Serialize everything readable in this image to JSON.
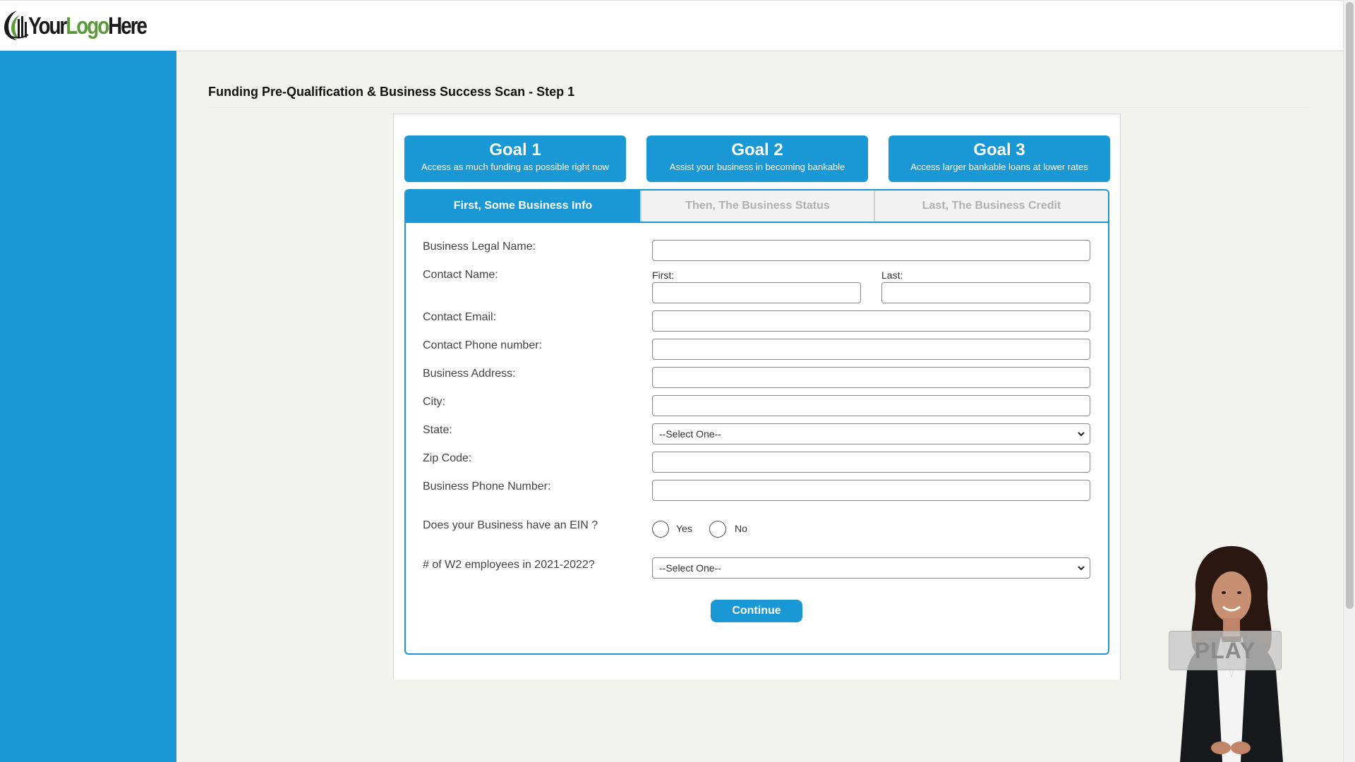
{
  "header": {
    "logo": {
      "your": "Your",
      "logo": "Logo",
      "here": "Here",
      "icon": "building-swoosh-icon"
    }
  },
  "page": {
    "title": "Funding Pre-Qualification & Business Success Scan - Step 1"
  },
  "goals": [
    {
      "title": "Goal 1",
      "subtitle": "Access as much funding as possible right now"
    },
    {
      "title": "Goal 2",
      "subtitle": "Assist your business in becoming bankable"
    },
    {
      "title": "Goal 3",
      "subtitle": "Access larger bankable loans at lower rates"
    }
  ],
  "tabs": [
    {
      "label": "First, Some Business Info",
      "active": true
    },
    {
      "label": "Then, The Business Status",
      "active": false
    },
    {
      "label": "Last, The Business Credit",
      "active": false
    }
  ],
  "form": {
    "business_legal_name": {
      "label": "Business Legal Name:",
      "value": ""
    },
    "contact_name": {
      "label": "Contact Name:",
      "first_label": "First:",
      "last_label": "Last:",
      "first_value": "",
      "last_value": ""
    },
    "contact_email": {
      "label": "Contact Email:",
      "value": ""
    },
    "contact_phone": {
      "label": "Contact Phone number:",
      "value": ""
    },
    "business_address": {
      "label": "Business Address:",
      "value": ""
    },
    "city": {
      "label": "City:",
      "value": ""
    },
    "state": {
      "label": "State:",
      "selected": "--Select One--"
    },
    "zip": {
      "label": "Zip Code:",
      "value": ""
    },
    "business_phone": {
      "label": "Business Phone Number:",
      "value": ""
    },
    "ein": {
      "label": "Does your Business have an EIN ?",
      "yes": "Yes",
      "no": "No"
    },
    "w2": {
      "label": "# of W2 employees in 2021-2022?",
      "selected": "--Select One--"
    },
    "continue_label": "Continue"
  },
  "video": {
    "play_label": "PLAY"
  },
  "colors": {
    "brand_blue": "#1a97d5",
    "logo_green": "#5a9a3a",
    "page_bg": "#f2f2ef"
  }
}
